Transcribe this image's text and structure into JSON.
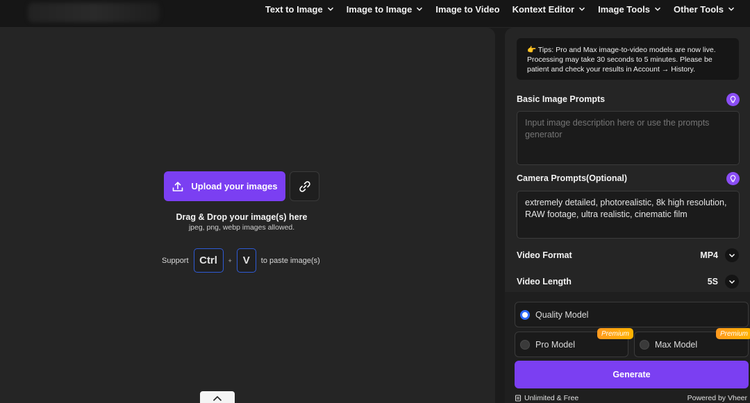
{
  "nav": {
    "items": [
      {
        "label": "Text to Image",
        "has_dropdown": true
      },
      {
        "label": "Image to Image",
        "has_dropdown": true
      },
      {
        "label": "Image to Video",
        "has_dropdown": false
      },
      {
        "label": "Kontext Editor",
        "has_dropdown": true
      },
      {
        "label": "Image Tools",
        "has_dropdown": true
      },
      {
        "label": "Other Tools",
        "has_dropdown": true
      }
    ]
  },
  "upload": {
    "button_label": "Upload your images",
    "drop_title": "Drag & Drop your image(s) here",
    "drop_subtitle": "jpeg, png, webp images allowed.",
    "paste_prefix": "Support",
    "key_ctrl": "Ctrl",
    "plus": "+",
    "key_v": "V",
    "paste_suffix": "to paste image(s)"
  },
  "settings": {
    "tips_text": "👉 Tips: Pro and Max image-to-video models are now live. Processing may take 30 seconds to 5 minutes. Please be patient and check your results in Account → History.",
    "basic_prompt_label": "Basic Image Prompts",
    "basic_prompt_placeholder": "Input image description here or use the prompts generator",
    "basic_prompt_value": "",
    "camera_prompt_label": "Camera Prompts(Optional)",
    "camera_prompt_value": "extremely detailed, photorealistic, 8k high resolution, RAW footage, ultra realistic, cinematic film",
    "video_format_label": "Video Format",
    "video_format_value": "MP4",
    "video_length_label": "Video Length",
    "video_length_value": "5S"
  },
  "models": {
    "quality_label": "Quality Model",
    "pro_label": "Pro Model",
    "max_label": "Max Model",
    "premium_badge": "Premium",
    "selected": "quality"
  },
  "actions": {
    "generate_label": "Generate"
  },
  "footer": {
    "left": "Unlimited & Free",
    "right": "Powered by Vheer"
  },
  "colors": {
    "accent": "#7b3ff2",
    "panel": "#252525",
    "background": "#1b1b1b",
    "premium": "#ffa31a",
    "radio_selected": "#2f6bff"
  }
}
